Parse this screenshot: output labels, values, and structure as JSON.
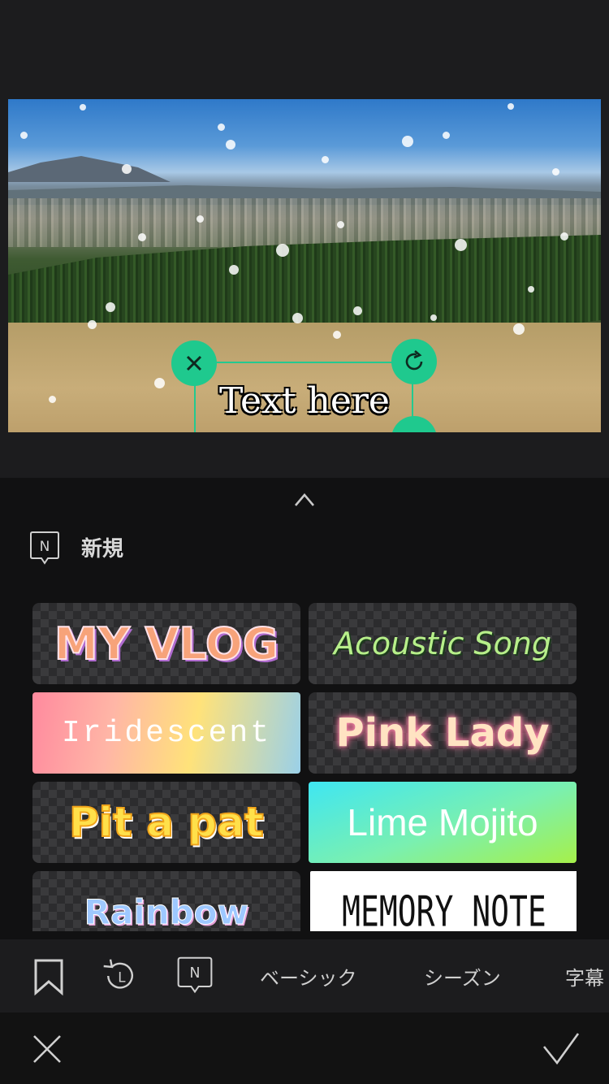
{
  "canvas": {
    "overlay_text": "Text here",
    "handles": {
      "delete": "close-icon",
      "rotate": "rotate-icon"
    }
  },
  "panel": {
    "expand_icon": "chevron-up-icon",
    "section": {
      "icon": "new-badge-icon",
      "badge_letter": "N",
      "title": "新規"
    },
    "templates": [
      {
        "label": "MY VLOG"
      },
      {
        "label": "Acoustic Song"
      },
      {
        "label": "Iridescent"
      },
      {
        "label": "Pink Lady"
      },
      {
        "label": "Pit a pat"
      },
      {
        "label": "Lime Mojito"
      },
      {
        "label": "Rainbow"
      },
      {
        "label": "MEMORY NOTE"
      }
    ]
  },
  "tabs": {
    "icons": [
      "bookmark-icon",
      "recent-icon",
      "new-badge-icon"
    ],
    "badge_letter": "N",
    "recent_letter": "L",
    "labels": [
      "ベーシック",
      "シーズン",
      "字幕"
    ]
  },
  "actions": {
    "cancel": "close-icon",
    "confirm": "checkmark-icon"
  },
  "colors": {
    "accent": "#1fc98e",
    "panel_bg": "#111112"
  }
}
